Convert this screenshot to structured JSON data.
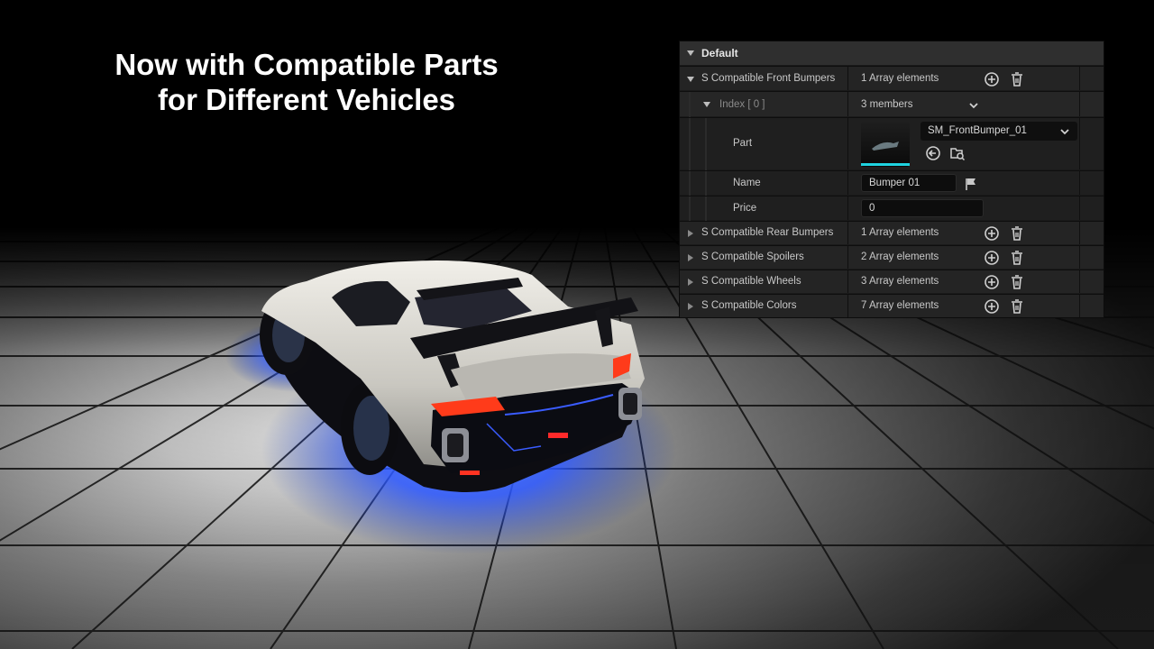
{
  "headline": {
    "line1": "Now with Compatible Parts",
    "line2": "for Different Vehicles"
  },
  "panel": {
    "category": "Default",
    "front_bumpers": {
      "label": "S Compatible Front Bumpers",
      "value": "1 Array elements"
    },
    "index": {
      "label": "Index [ 0 ]",
      "value": "3 members"
    },
    "part": {
      "label": "Part",
      "asset": "SM_FrontBumper_01"
    },
    "name": {
      "label": "Name",
      "value": "Bumper 01"
    },
    "price": {
      "label": "Price",
      "value": "0"
    },
    "rear_bumpers": {
      "label": "S Compatible Rear Bumpers",
      "value": "1 Array elements"
    },
    "spoilers": {
      "label": "S Compatible Spoilers",
      "value": "2 Array elements"
    },
    "wheels": {
      "label": "S Compatible Wheels",
      "value": "3 Array elements"
    },
    "colors": {
      "label": "S Compatible Colors",
      "value": "7 Array elements"
    }
  },
  "icons": {
    "add": "add-element-icon",
    "delete": "trash-icon",
    "browse": "browse-asset-icon",
    "use_selected": "use-selected-asset-icon",
    "localize": "flag-icon",
    "expand": "triangle-icon"
  },
  "colors": {
    "panel_bg": "#1a1a1a",
    "header_bg": "#2f2f2f",
    "underglow": "#2a5cff",
    "taillight": "#ff3b1a",
    "thumbnail_accent": "#1fd3e0"
  }
}
